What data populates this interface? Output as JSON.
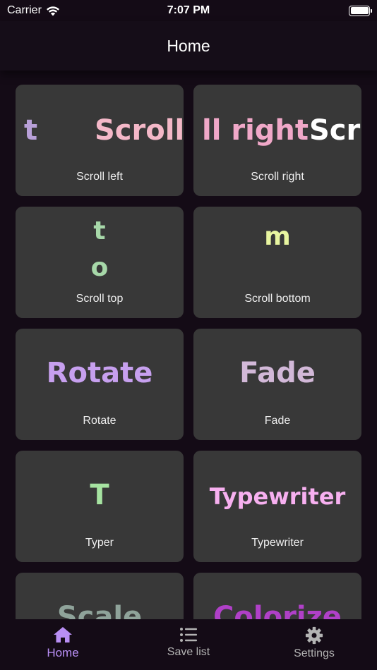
{
  "status_bar": {
    "carrier": "Carrier",
    "time": "7:07 PM"
  },
  "header": {
    "title": "Home"
  },
  "tiles": [
    {
      "label": "Scroll left",
      "preview": [
        "t",
        "Scroll"
      ],
      "color": "#f4b8c8"
    },
    {
      "label": "Scroll right",
      "preview": [
        "ll right",
        "Scr"
      ],
      "color": "#f0a8c8"
    },
    {
      "label": "Scroll top",
      "preview": [
        "t",
        "o"
      ],
      "color": "#a7d8a9"
    },
    {
      "label": "Scroll bottom",
      "preview": [
        "m"
      ],
      "color": "#e8f5a0"
    },
    {
      "label": "Rotate",
      "preview": [
        "Rotate"
      ],
      "color": "#c7a0ef"
    },
    {
      "label": "Fade",
      "preview": [
        "Fade"
      ],
      "color": "#d2b8d8"
    },
    {
      "label": "Typer",
      "preview": [
        "T"
      ],
      "color": "#a6e3a1"
    },
    {
      "label": "Typewriter",
      "preview": [
        "Typewriter"
      ],
      "color": "#f7b0f0"
    },
    {
      "label": "",
      "preview": [
        "Scale"
      ],
      "color": "#8fa39a"
    },
    {
      "label": "",
      "preview": [
        "Colorize"
      ],
      "color": "#b040c8"
    }
  ],
  "tab_bar": {
    "items": [
      {
        "label": "Home",
        "icon": "home-icon",
        "active": true
      },
      {
        "label": "Save list",
        "icon": "list-icon",
        "active": false
      },
      {
        "label": "Settings",
        "icon": "gear-icon",
        "active": false
      }
    ],
    "accent": "#b98ff5"
  }
}
